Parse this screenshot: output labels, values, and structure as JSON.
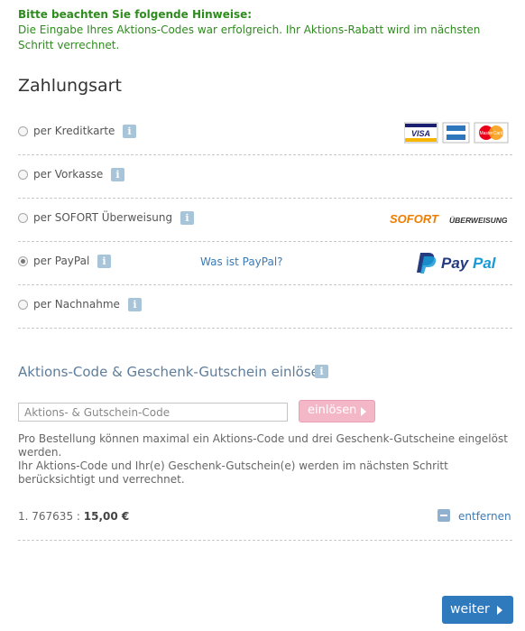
{
  "notice": {
    "title": "Bitte beachten Sie folgende Hinweise:",
    "text": "Die Eingabe Ihres Aktions-Codes war erfolgreich. Ihr Aktions-Rabatt wird im nächsten Schritt verrechnet."
  },
  "payment": {
    "heading": "Zahlungsart",
    "info_glyph": "i",
    "methods": [
      {
        "label": "per Kreditkarte",
        "selected": false,
        "icon": "credit-card-logos"
      },
      {
        "label": "per Vorkasse",
        "selected": false
      },
      {
        "label": "per SOFORT Überweisung",
        "selected": false,
        "icon": "sofort-logo"
      },
      {
        "label": "per PayPal",
        "selected": true,
        "icon": "paypal-logo"
      },
      {
        "label": "per Nachnahme",
        "selected": false
      }
    ],
    "paypal_link": "Was ist PayPal?"
  },
  "logos": {
    "visa": "VISA",
    "mastercard": "MasterCard",
    "sofort": "SOFORT",
    "sofort_sub": "ÜBERWEISUNG",
    "paypal_a": "Pay",
    "paypal_b": "Pal"
  },
  "voucher": {
    "heading": "Aktions-Code & Geschenk-Gutschein einlösen",
    "placeholder": "Aktions- & Gutschein-Code",
    "button": "einlösen",
    "hint_1": "Pro Bestellung können maximal ein Aktions-Code und drei Geschenk-Gutscheine eingelöst werden.",
    "hint_2": "Ihr Aktions-Code und Ihr(e) Geschenk-Gutschein(e) werden im nächsten Schritt berücksichtigt und verrechnet.",
    "applied": {
      "prefix": "1. 767635 :",
      "amount": "15,00 €"
    },
    "remove_label": "entfernen"
  },
  "next_button": "weiter",
  "colors": {
    "notice": "#2e8b1e",
    "link": "#3b7bb5",
    "primary_button": "#2f79bd",
    "redeem_button": "#f4b7c7",
    "info_icon": "#a8c4d8"
  }
}
